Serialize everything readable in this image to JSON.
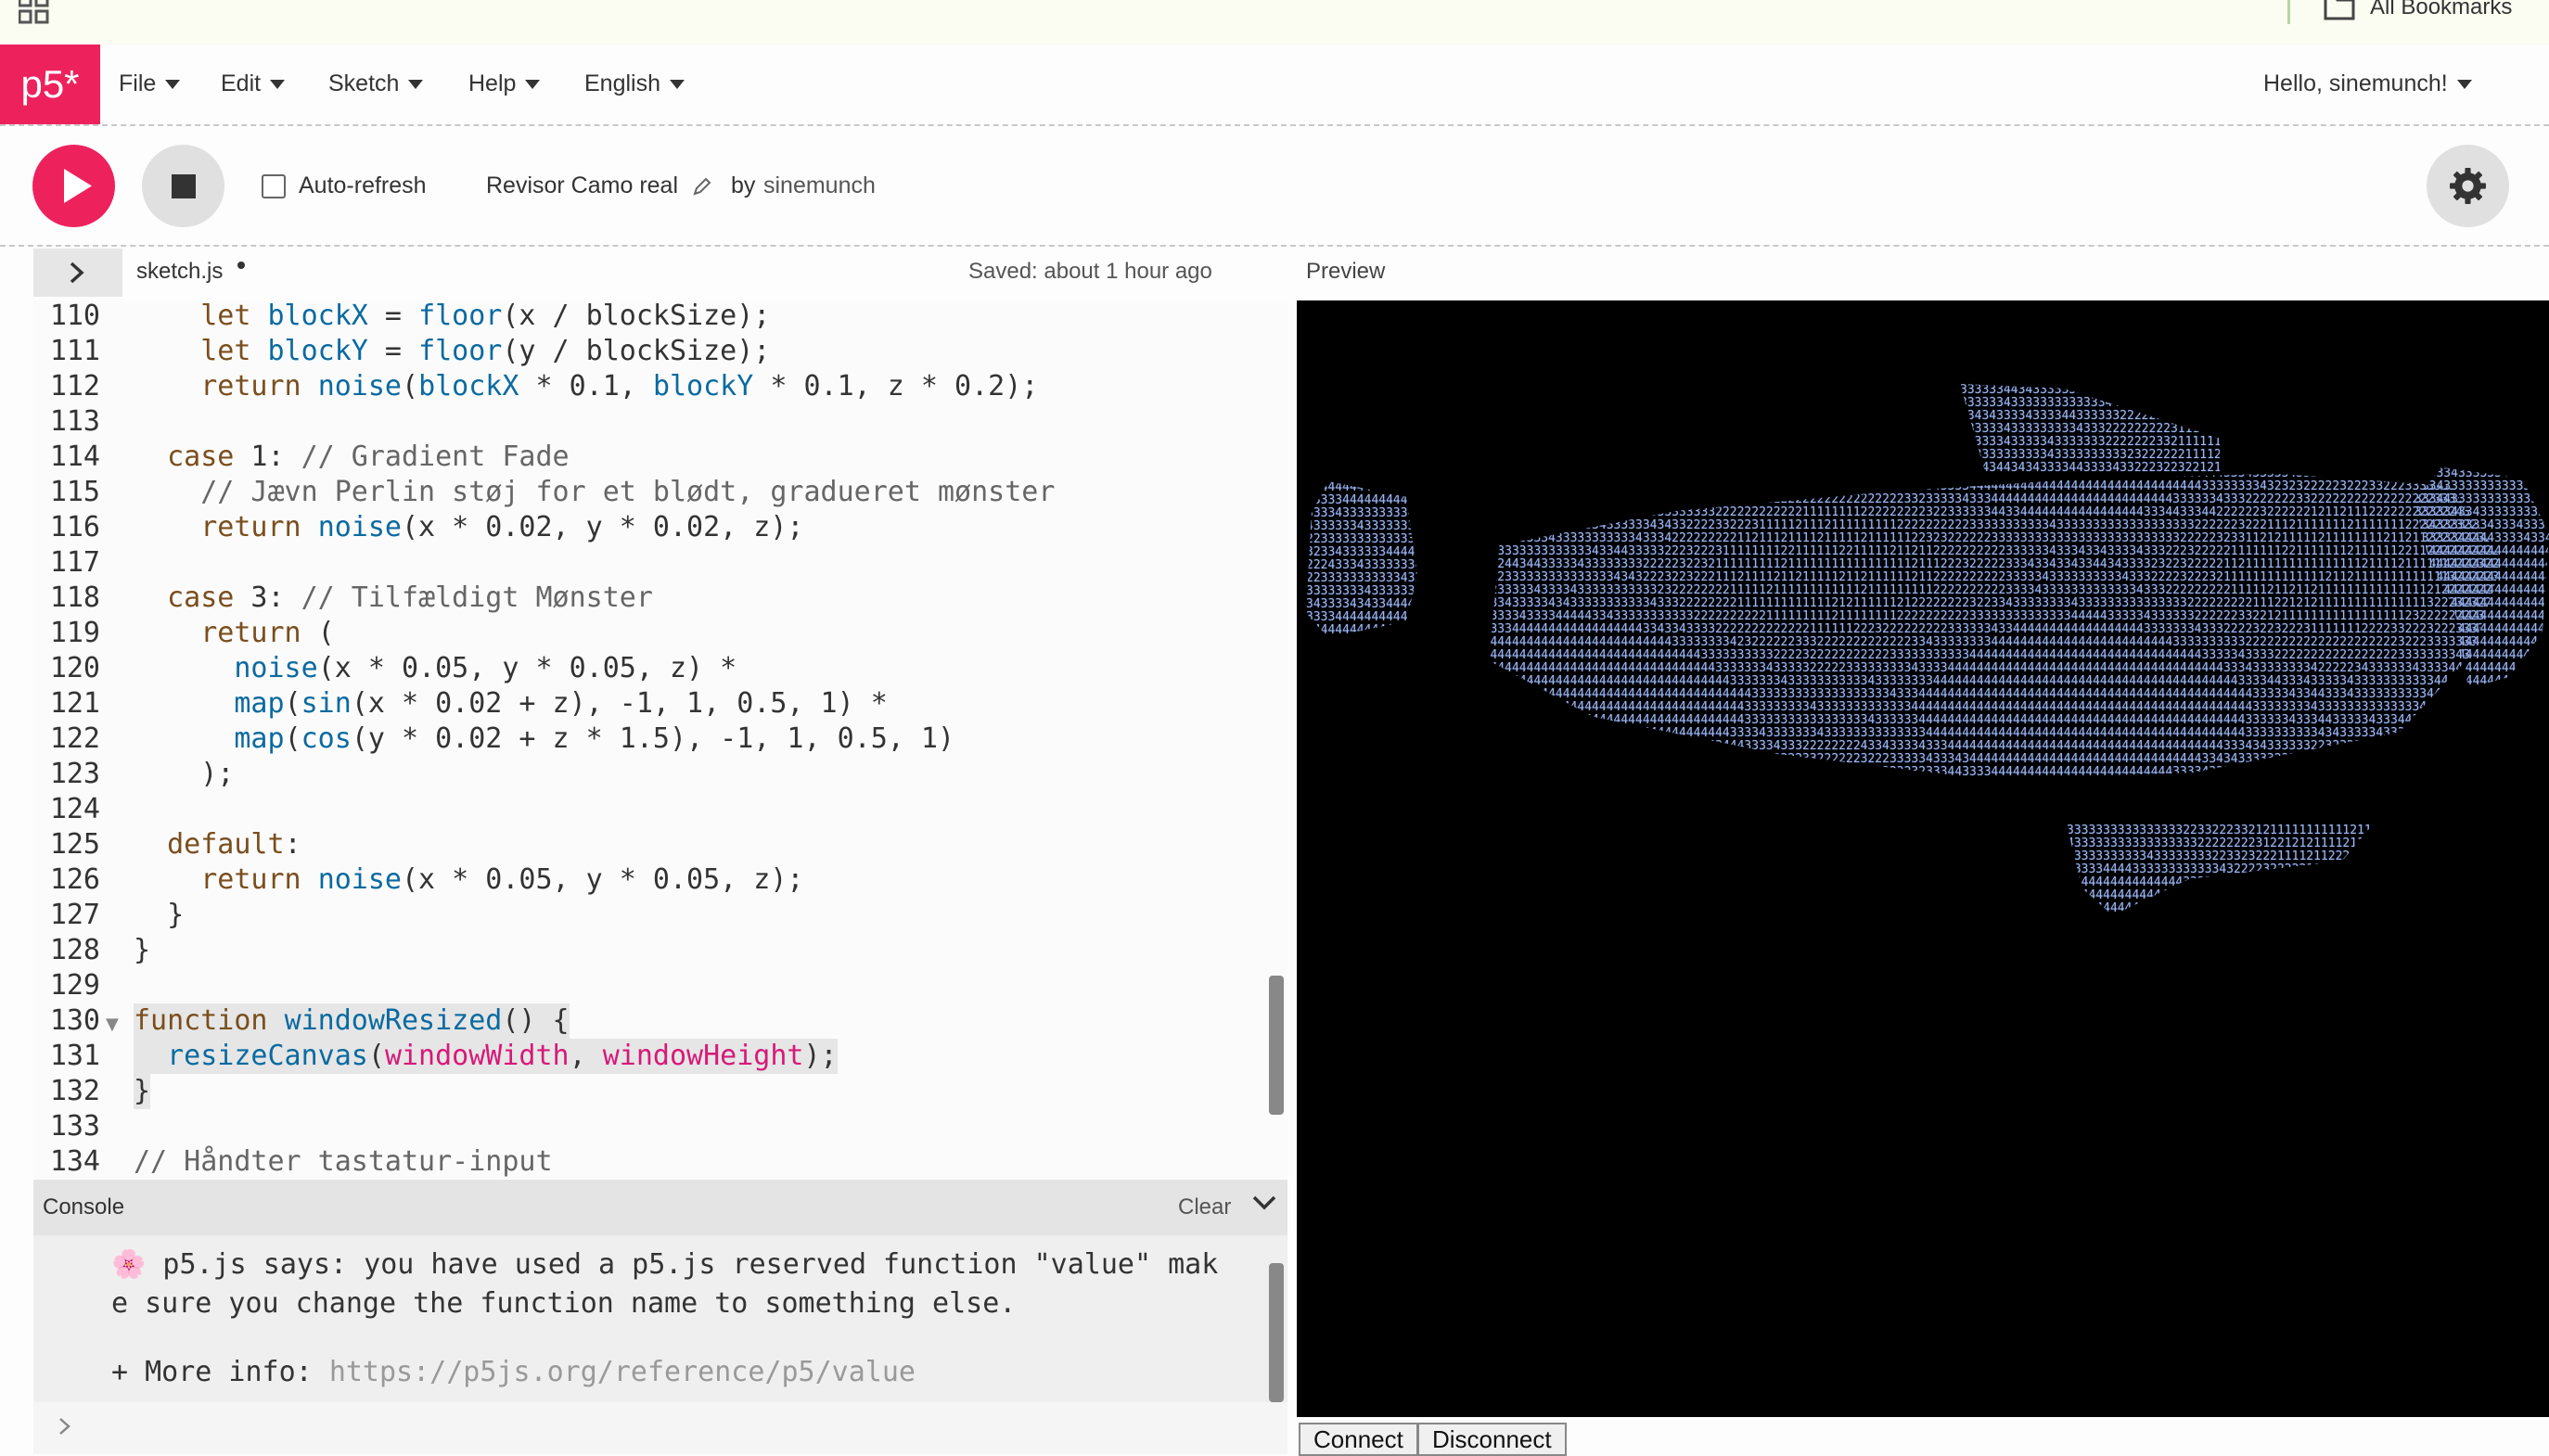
{
  "browser": {
    "bookmarks_label": "All Bookmarks"
  },
  "nav": {
    "logo": "p5*",
    "menus": [
      "File",
      "Edit",
      "Sketch",
      "Help",
      "English"
    ],
    "user": "Hello, sinemunch!"
  },
  "toolbar": {
    "autorefresh_label": "Auto-refresh",
    "autorefresh_checked": false,
    "sketch_name": "Revisor Camo real",
    "by_label": "by",
    "author": "sinemunch"
  },
  "editor": {
    "file_name": "sketch.js",
    "saved_status": "Saved: about 1 hour ago",
    "preview_label": "Preview",
    "lines": [
      {
        "n": "110",
        "code": "    let blockX = floor(x / blockSize);"
      },
      {
        "n": "111",
        "code": "    let blockY = floor(y / blockSize);"
      },
      {
        "n": "112",
        "code": "    return noise(blockX * 0.1, blockY * 0.1, z * 0.2);"
      },
      {
        "n": "113",
        "code": ""
      },
      {
        "n": "114",
        "code": "  case 1: // Gradient Fade"
      },
      {
        "n": "115",
        "code": "    // Jævn Perlin støj for et blødt, gradueret mønster"
      },
      {
        "n": "116",
        "code": "    return noise(x * 0.02, y * 0.02, z);"
      },
      {
        "n": "117",
        "code": ""
      },
      {
        "n": "118",
        "code": "  case 3: // Tilfældigt Mønster"
      },
      {
        "n": "119",
        "code": "    return ("
      },
      {
        "n": "120",
        "code": "      noise(x * 0.05, y * 0.05, z) *"
      },
      {
        "n": "121",
        "code": "      map(sin(x * 0.02 + z), -1, 1, 0.5, 1) *"
      },
      {
        "n": "122",
        "code": "      map(cos(y * 0.02 + z * 1.5), -1, 1, 0.5, 1)"
      },
      {
        "n": "123",
        "code": "    );"
      },
      {
        "n": "124",
        "code": ""
      },
      {
        "n": "125",
        "code": "  default:"
      },
      {
        "n": "126",
        "code": "    return noise(x * 0.05, y * 0.05, z);"
      },
      {
        "n": "127",
        "code": "  }"
      },
      {
        "n": "128",
        "code": "}"
      },
      {
        "n": "129",
        "code": ""
      },
      {
        "n": "130",
        "code": "function windowResized() {"
      },
      {
        "n": "131",
        "code": "  resizeCanvas(windowWidth, windowHeight);"
      },
      {
        "n": "132",
        "code": "}"
      },
      {
        "n": "133",
        "code": ""
      },
      {
        "n": "134",
        "code": "// Håndter tastatur-input"
      }
    ]
  },
  "console": {
    "title": "Console",
    "clear_label": "Clear",
    "message_line1": "🌸 p5.js says: you have used a p5.js reserved function \"value\" mak",
    "message_line2": "e sure you change the function name to something else.",
    "more_info_label": "+ More info: ",
    "more_info_link": "https://p5js.org/reference/p5/value"
  },
  "serial": {
    "connect_label": "Connect",
    "disconnect_label": "Disconnect"
  },
  "colors": {
    "accent": "#ed225d",
    "ascii_art": "#9fb6e6"
  },
  "icons": [
    "apps-grid-icon",
    "folder-icon",
    "caret-down-icon",
    "play-icon",
    "stop-icon",
    "pencil-icon",
    "gear-icon",
    "chevron-right-icon",
    "chevron-down-icon",
    "fold-triangle-icon",
    "prompt-chevron-icon"
  ]
}
